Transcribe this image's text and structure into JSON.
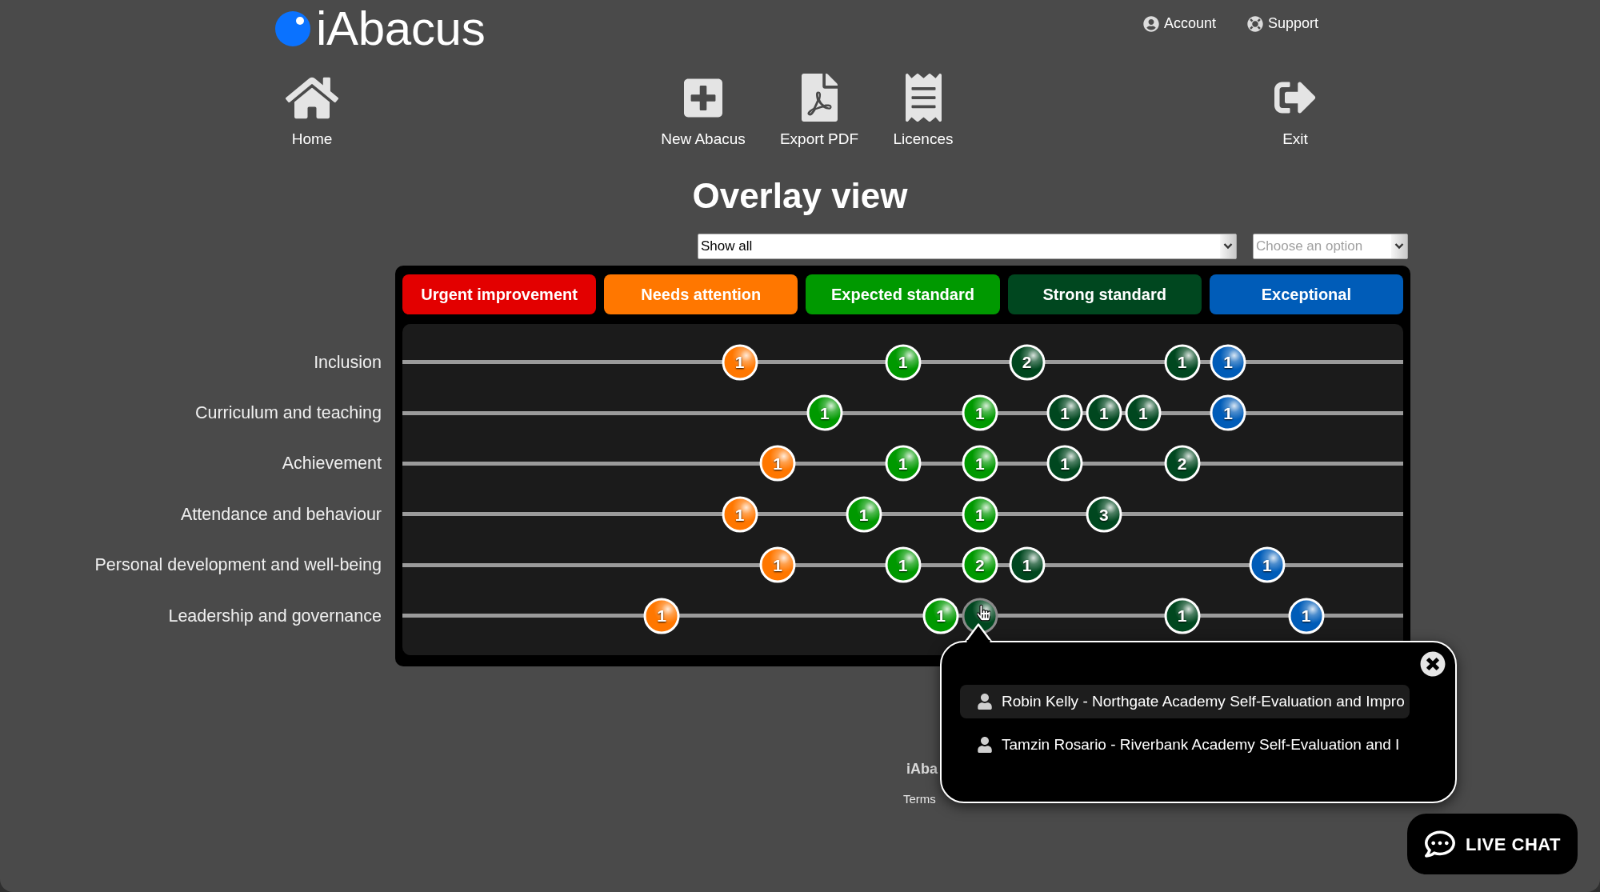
{
  "logo": {
    "text": "iAbacus"
  },
  "top_links": [
    {
      "label": "Account"
    },
    {
      "label": "Support"
    }
  ],
  "nav": [
    {
      "label": "Home"
    },
    {
      "label": "New Abacus"
    },
    {
      "label": "Export PDF"
    },
    {
      "label": "Licences"
    },
    {
      "label": "Exit"
    }
  ],
  "title": "Overlay view",
  "filters": [
    {
      "value": "Show all"
    },
    {
      "placeholder": "Choose an option"
    }
  ],
  "legend": [
    {
      "label": "Urgent improvement",
      "color": "#e30000"
    },
    {
      "label": "Needs attention",
      "color": "#ff7700"
    },
    {
      "label": "Expected standard",
      "color": "#009900"
    },
    {
      "label": "Strong standard",
      "color": "#00471f"
    },
    {
      "label": "Exceptional",
      "color": "#005cb8"
    }
  ],
  "rows": [
    {
      "label": "Inclusion",
      "beads": [
        {
          "count": "1",
          "color": "#ff7700",
          "level": 0.337,
          "hovered": false
        },
        {
          "count": "1",
          "color": "#009900",
          "level": 0.5,
          "hovered": false
        },
        {
          "count": "2",
          "color": "#00471f",
          "level": 0.624,
          "hovered": false
        },
        {
          "count": "1",
          "color": "#00471f",
          "level": 0.779,
          "hovered": false
        },
        {
          "count": "1",
          "color": "#005cb8",
          "level": 0.825,
          "hovered": false
        }
      ]
    },
    {
      "label": "Curriculum and teaching",
      "beads": [
        {
          "count": "1",
          "color": "#009900",
          "level": 0.422,
          "hovered": false
        },
        {
          "count": "1",
          "color": "#009900",
          "level": 0.577,
          "hovered": false
        },
        {
          "count": "1",
          "color": "#00471f",
          "level": 0.662,
          "hovered": false
        },
        {
          "count": "1",
          "color": "#00471f",
          "level": 0.701,
          "hovered": false
        },
        {
          "count": "1",
          "color": "#00471f",
          "level": 0.74,
          "hovered": false
        },
        {
          "count": "1",
          "color": "#005cb8",
          "level": 0.825,
          "hovered": false
        }
      ]
    },
    {
      "label": "Achievement",
      "beads": [
        {
          "count": "1",
          "color": "#ff7700",
          "level": 0.375,
          "hovered": false
        },
        {
          "count": "1",
          "color": "#009900",
          "level": 0.5,
          "hovered": false
        },
        {
          "count": "1",
          "color": "#009900",
          "level": 0.577,
          "hovered": false
        },
        {
          "count": "1",
          "color": "#00471f",
          "level": 0.662,
          "hovered": false
        },
        {
          "count": "2",
          "color": "#00471f",
          "level": 0.779,
          "hovered": false
        }
      ]
    },
    {
      "label": "Attendance and behaviour",
      "beads": [
        {
          "count": "1",
          "color": "#ff7700",
          "level": 0.337,
          "hovered": false
        },
        {
          "count": "1",
          "color": "#009900",
          "level": 0.461,
          "hovered": false
        },
        {
          "count": "1",
          "color": "#009900",
          "level": 0.577,
          "hovered": false
        },
        {
          "count": "3",
          "color": "#00471f",
          "level": 0.701,
          "hovered": false
        }
      ]
    },
    {
      "label": "Personal development and well-being",
      "beads": [
        {
          "count": "1",
          "color": "#ff7700",
          "level": 0.375,
          "hovered": false
        },
        {
          "count": "1",
          "color": "#009900",
          "level": 0.5,
          "hovered": false
        },
        {
          "count": "2",
          "color": "#009900",
          "level": 0.577,
          "hovered": false
        },
        {
          "count": "1",
          "color": "#00471f",
          "level": 0.624,
          "hovered": false
        },
        {
          "count": "1",
          "color": "#005cb8",
          "level": 0.864,
          "hovered": false
        }
      ]
    },
    {
      "label": "Leadership and governance",
      "beads": [
        {
          "count": "1",
          "color": "#ff7700",
          "level": 0.259,
          "hovered": false
        },
        {
          "count": "1",
          "color": "#009900",
          "level": 0.538,
          "hovered": false
        },
        {
          "color": "#00471f",
          "level": 0.577,
          "hovered": true
        },
        {
          "count": "1",
          "color": "#00471f",
          "level": 0.779,
          "hovered": false
        },
        {
          "count": "1",
          "color": "#005cb8",
          "level": 0.903,
          "hovered": false
        }
      ]
    }
  ],
  "footer": {
    "brand": "iAba",
    "link": "Terms"
  },
  "popup": {
    "items": [
      {
        "text": "Robin Kelly - Northgate Academy Self-Evaluation and Impro",
        "selected": true
      },
      {
        "text": "Tamzin Rosario - Riverbank Academy Self-Evaluation and I",
        "selected": false
      }
    ]
  },
  "live_chat": {
    "label": "LIVE CHAT"
  }
}
